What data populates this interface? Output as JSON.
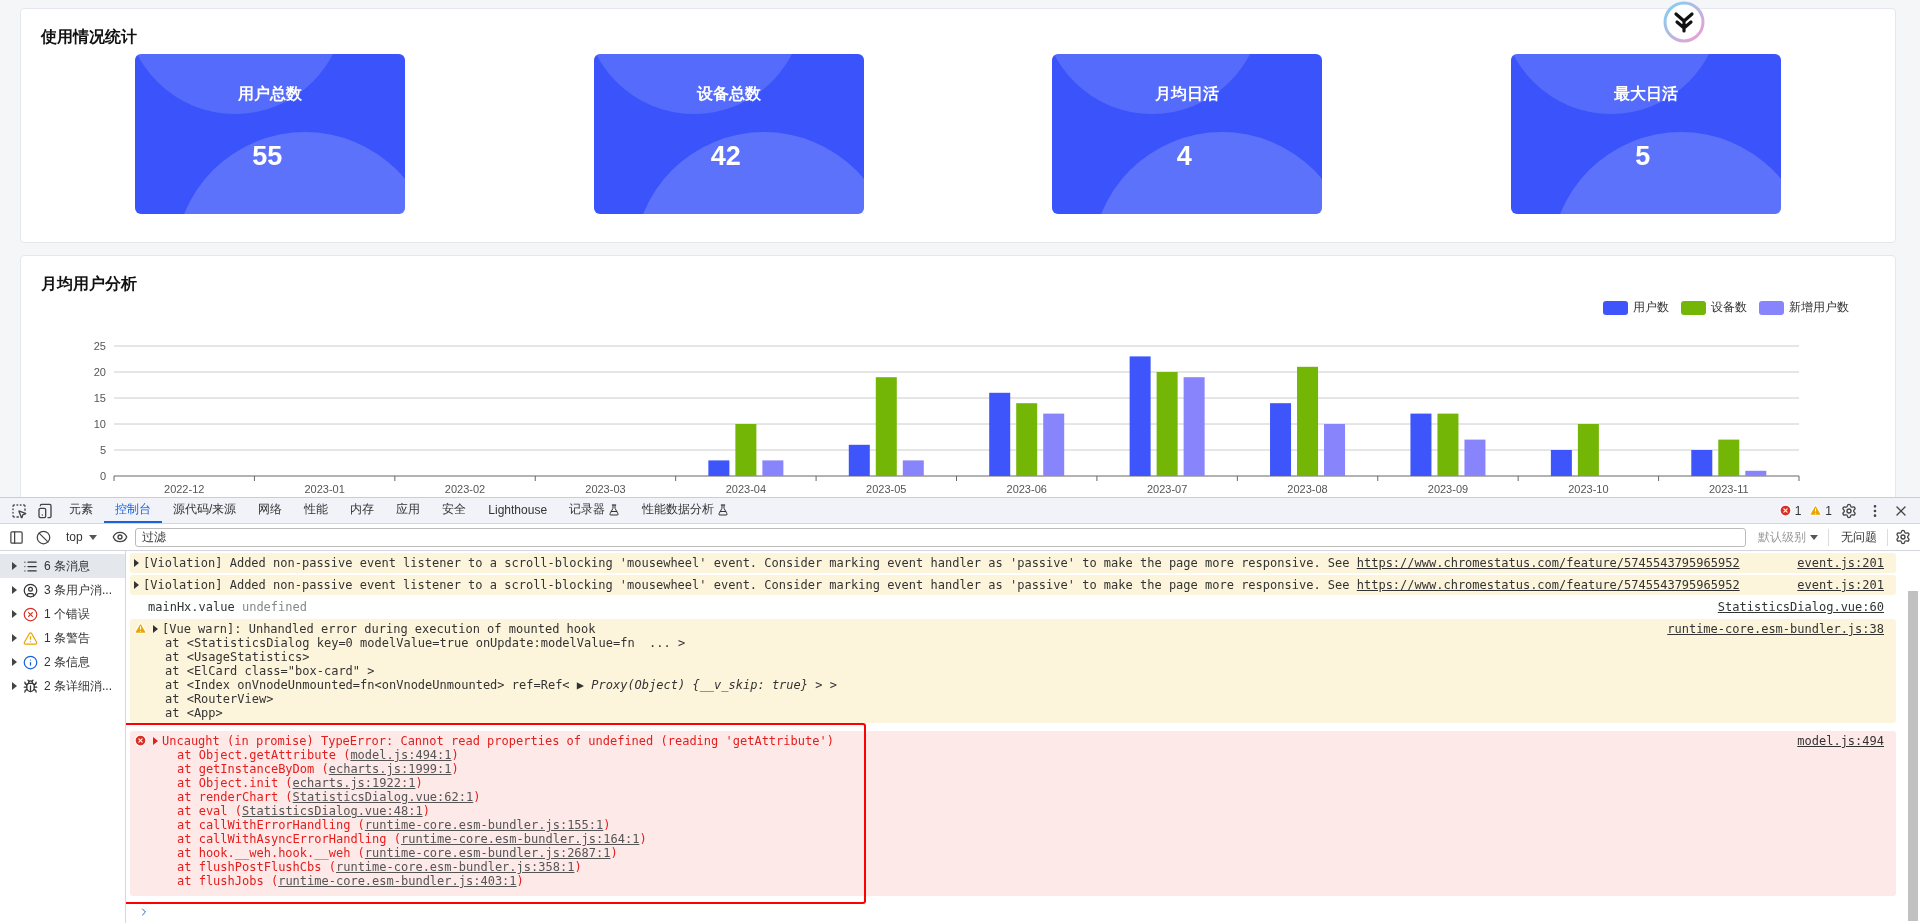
{
  "usage_stats": {
    "title": "使用情况统计",
    "cards": [
      {
        "label": "用户总数",
        "value": "55"
      },
      {
        "label": "设备总数",
        "value": "42"
      },
      {
        "label": "月均日活",
        "value": "4"
      },
      {
        "label": "最大日活",
        "value": "5"
      }
    ]
  },
  "monthly_analysis": {
    "title": "月均用户分析",
    "chart_data": {
      "type": "bar",
      "categories": [
        "2022-12",
        "2023-01",
        "2023-02",
        "2023-03",
        "2023-04",
        "2023-05",
        "2023-06",
        "2023-07",
        "2023-08",
        "2023-09",
        "2023-10",
        "2023-11"
      ],
      "series": [
        {
          "name": "用户数",
          "color": "#3d55fb",
          "values": [
            0,
            0,
            0,
            0,
            3,
            6,
            16,
            23,
            14,
            12,
            5,
            5
          ]
        },
        {
          "name": "设备数",
          "color": "#73b605",
          "values": [
            0,
            0,
            0,
            0,
            10,
            19,
            14,
            20,
            21,
            12,
            10,
            7
          ]
        },
        {
          "name": "新增用户数",
          "color": "#8884fb",
          "values": [
            0,
            0,
            0,
            0,
            3,
            3,
            12,
            19,
            10,
            7,
            0,
            1
          ]
        }
      ],
      "ylim": [
        0,
        25
      ],
      "grid": true,
      "legend": "top-right",
      "yticks": [
        0,
        5,
        10,
        15,
        20,
        25
      ]
    }
  },
  "devtools": {
    "tabs": [
      {
        "label": "元素",
        "selected": false,
        "experimental": false
      },
      {
        "label": "控制台",
        "selected": true,
        "experimental": false
      },
      {
        "label": "源代码/来源",
        "selected": false,
        "experimental": false
      },
      {
        "label": "网络",
        "selected": false,
        "experimental": false
      },
      {
        "label": "性能",
        "selected": false,
        "experimental": false
      },
      {
        "label": "内存",
        "selected": false,
        "experimental": false
      },
      {
        "label": "应用",
        "selected": false,
        "experimental": false
      },
      {
        "label": "安全",
        "selected": false,
        "experimental": false
      },
      {
        "label": "Lighthouse",
        "selected": false,
        "experimental": false
      },
      {
        "label": "记录器",
        "selected": false,
        "experimental": true
      },
      {
        "label": "性能数据分析",
        "selected": false,
        "experimental": true
      }
    ],
    "error_count": "1",
    "warning_count": "1",
    "context": "top",
    "filter": {
      "placeholder": "过滤"
    },
    "level": "默认级别",
    "issues": "无问题",
    "sidebar": [
      {
        "kind": "messages",
        "label": "6 条消息",
        "selected": true
      },
      {
        "kind": "user",
        "label": "3 条用户消...",
        "selected": false
      },
      {
        "kind": "error",
        "label": "1 个错误",
        "selected": false
      },
      {
        "kind": "warning",
        "label": "1 条警告",
        "selected": false
      },
      {
        "kind": "info",
        "label": "2 条信息",
        "selected": false
      },
      {
        "kind": "verbose",
        "label": "2 条详细消...",
        "selected": false
      }
    ],
    "messages": [
      {
        "kind": "violation",
        "text": "[Violation] Added non-passive event listener to a scroll-blocking 'mousewheel' event. Consider marking event handler as 'passive' to make the page more responsive. See",
        "link": "https://www.chromestatus.com/feature/5745543795965952",
        "source": "event.js:201"
      },
      {
        "kind": "violation",
        "text": "[Violation] Added non-passive event listener to a scroll-blocking 'mousewheel' event. Consider marking event handler as 'passive' to make the page more responsive. See",
        "link": "https://www.chromestatus.com/feature/5745543795965952",
        "source": "event.js:201"
      },
      {
        "kind": "log",
        "text": "mainHx.value",
        "value": "undefined",
        "source": "StatisticsDialog.vue:60"
      },
      {
        "kind": "warning",
        "title": "[Vue warn]: Unhandled error during execution of mounted hook",
        "lines": [
          "at <StatisticsDialog key=0 modelValue=true onUpdate:modelValue=fn  ... >",
          "at <UsageStatistics>",
          "at <ElCard class=\"box-card\" >",
          "at <Index onVnodeUnmounted=fn<onVnodeUnmounted> ref=Ref< ▶ *Proxy(Object) {__v_skip: true}* > >",
          "at <RouterView>",
          "at <App>"
        ],
        "source": "runtime-core.esm-bundler.js:38"
      },
      {
        "kind": "error",
        "title": "Uncaught (in promise) TypeError: Cannot read properties of undefined (reading 'getAttribute')",
        "frames": [
          {
            "prefix": "at Object.getAttribute (",
            "location": "model.js:494:1",
            "suffix": ")"
          },
          {
            "prefix": "at getInstanceByDom (",
            "location": "echarts.js:1999:1",
            "suffix": ")"
          },
          {
            "prefix": "at Object.init (",
            "location": "echarts.js:1922:1",
            "suffix": ")"
          },
          {
            "prefix": "at renderChart (",
            "location": "StatisticsDialog.vue:62:1",
            "suffix": ")"
          },
          {
            "prefix": "at eval (",
            "location": "StatisticsDialog.vue:48:1",
            "suffix": ")"
          },
          {
            "prefix": "at callWithErrorHandling (",
            "location": "runtime-core.esm-bundler.js:155:1",
            "suffix": ")"
          },
          {
            "prefix": "at callWithAsyncErrorHandling (",
            "location": "runtime-core.esm-bundler.js:164:1",
            "suffix": ")"
          },
          {
            "prefix": "at hook.__weh.hook.__weh (",
            "location": "runtime-core.esm-bundler.js:2687:1",
            "suffix": ")"
          },
          {
            "prefix": "at flushPostFlushCbs (",
            "location": "runtime-core.esm-bundler.js:358:1",
            "suffix": ")"
          },
          {
            "prefix": "at flushJobs (",
            "location": "runtime-core.esm-bundler.js:403:1",
            "suffix": ")"
          }
        ],
        "source": "model.js:494"
      }
    ]
  }
}
